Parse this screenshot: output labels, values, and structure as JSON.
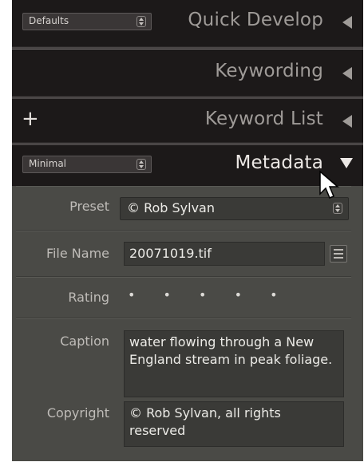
{
  "panels": [
    {
      "title": "Quick Develop",
      "preset": "Defaults"
    },
    {
      "title": "Keywording"
    },
    {
      "title": "Keyword List",
      "add_symbol": "+"
    },
    {
      "title": "Metadata",
      "preset": "Minimal"
    }
  ],
  "metadata": {
    "preset": {
      "label": "Preset",
      "value": "© Rob Sylvan"
    },
    "file_name": {
      "label": "File Name",
      "value": "20071019.tif"
    },
    "rating": {
      "label": "Rating",
      "value": "• • • • •"
    },
    "caption": {
      "label": "Caption",
      "value": "water flowing through a New England stream in peak foliage."
    },
    "copyright": {
      "label": "Copyright",
      "value": "© Rob Sylvan, all rights reserved"
    }
  },
  "colors": {
    "panel_bg": "#1a1717",
    "metadata_bg": "#4a4a46",
    "title_dim": "#9f9b98",
    "title_bright": "#ece8e5"
  }
}
